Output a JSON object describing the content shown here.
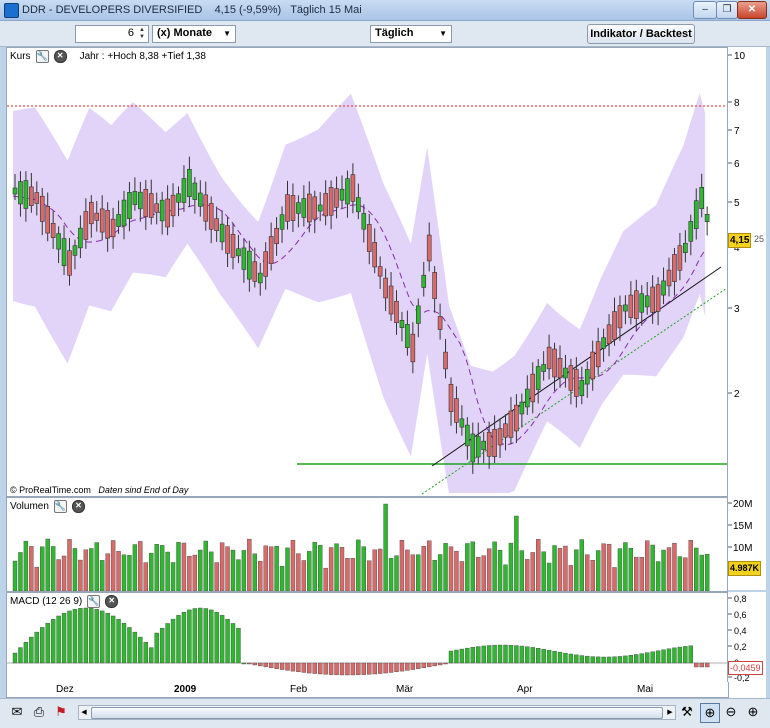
{
  "window": {
    "title": "DDR - DEVELOPERS DIVERSIFIED",
    "price_change": "4,15 (-9,59%)",
    "date_info": "Täglich 15 Mai",
    "controls": {
      "min": "–",
      "restore": "❐",
      "close": "✕",
      "min2": "–",
      "restore2": "❐",
      "close2": "✕"
    }
  },
  "toolbar": {
    "period_value": "6",
    "period_unit": "(x) Monate",
    "interval": "Täglich",
    "indicator_button": "Indikator / Backtest"
  },
  "price_panel": {
    "label": "Kurs",
    "info": "Jahr : +Hoch 8,38 +Tief 1,38",
    "credit": "© ProRealTime.com",
    "credit_note": "Daten sind End of Day",
    "y_ticks": [
      "10",
      "8",
      "7",
      "6",
      "5",
      "4",
      "3",
      "2"
    ],
    "last_price": "4,15",
    "last_price_suffix": "25"
  },
  "volume_panel": {
    "label": "Volumen",
    "y_ticks": [
      "20M",
      "15M",
      "10M"
    ],
    "last_value": "4.987K"
  },
  "macd_panel": {
    "label": "MACD (12 26 9)",
    "y_ticks": [
      "0,8",
      "0,6",
      "0,4",
      "0,2",
      "0",
      "-0,2"
    ],
    "last_value": "-0,0459"
  },
  "x_axis": {
    "labels": [
      "Dez",
      "2009",
      "Feb",
      "Mär",
      "Apr",
      "Mai"
    ]
  },
  "colors": {
    "up": "#2fb82f",
    "down": "#d96a6a",
    "band": "#dcccf7",
    "support": "#1fa31f",
    "resistance": "#e02020",
    "trend": "#111111",
    "sma": "#8a2ab0"
  },
  "icons": {
    "wrench": "wrench-icon",
    "close": "close-icon",
    "mail": "mail-icon",
    "print": "print-icon",
    "flag": "flag-icon",
    "zoom": "zoom-icon",
    "tool": "tool-icon"
  }
}
